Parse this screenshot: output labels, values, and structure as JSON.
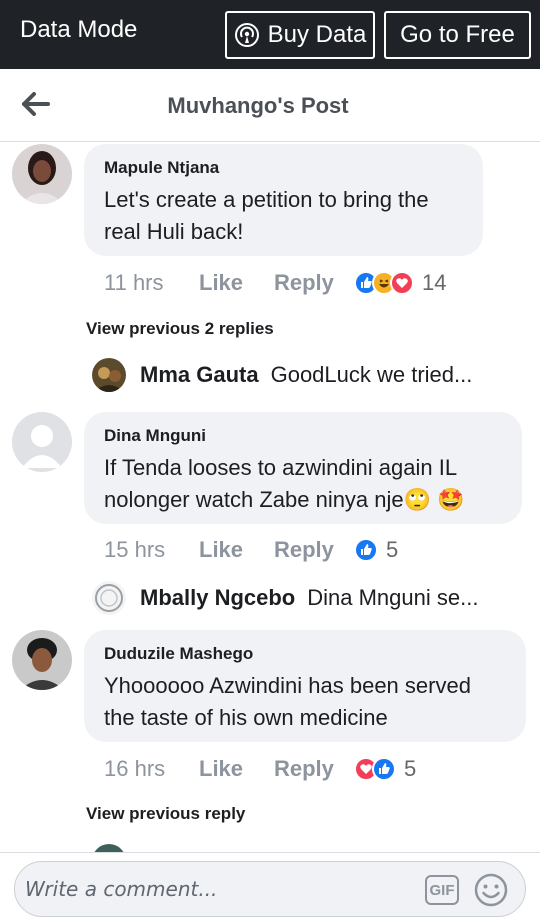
{
  "topbar": {
    "mode_label": "Data Mode",
    "buy_label": "Buy Data",
    "free_label": "Go to Free"
  },
  "header": {
    "title": "Muvhango's Post"
  },
  "comments": [
    {
      "author": "Mapule Ntjana",
      "text": "Let's create a petition to bring the real Huli back!",
      "time": "11 hrs",
      "like": "Like",
      "reply": "Reply",
      "reactions": [
        "like-icon",
        "haha-icon",
        "love-icon"
      ],
      "reaction_count": "14",
      "view_previous": "View previous 2 replies",
      "reply_preview": {
        "author": "Mma Gauta",
        "text": "GoodLuck we tried..."
      }
    },
    {
      "author": "Dina Mnguni",
      "text": "If  Tenda looses to azwindini again IL nolonger watch Zabe ninya nje🙄 🤩",
      "time": "15 hrs",
      "like": "Like",
      "reply": "Reply",
      "reactions": [
        "like-icon"
      ],
      "reaction_count": "5",
      "reply_preview": {
        "author": "Mbally Ngcebo",
        "text": "Dina Mnguni se..."
      }
    },
    {
      "author": "Duduzile Mashego",
      "text": "Yhoooooo Azwindini has been served the taste of his own medicine",
      "time": "16 hrs",
      "like": "Like",
      "reply": "Reply",
      "reactions": [
        "love-icon",
        "like-icon"
      ],
      "reaction_count": "5",
      "view_previous": "View previous reply"
    }
  ],
  "composer": {
    "placeholder": "Write a comment...",
    "gif_label": "GIF"
  },
  "colors": {
    "topbar_bg": "#1f2328",
    "like_blue": "#1877f2",
    "love_red": "#f33e58",
    "bubble_bg": "#f0f2f5"
  }
}
